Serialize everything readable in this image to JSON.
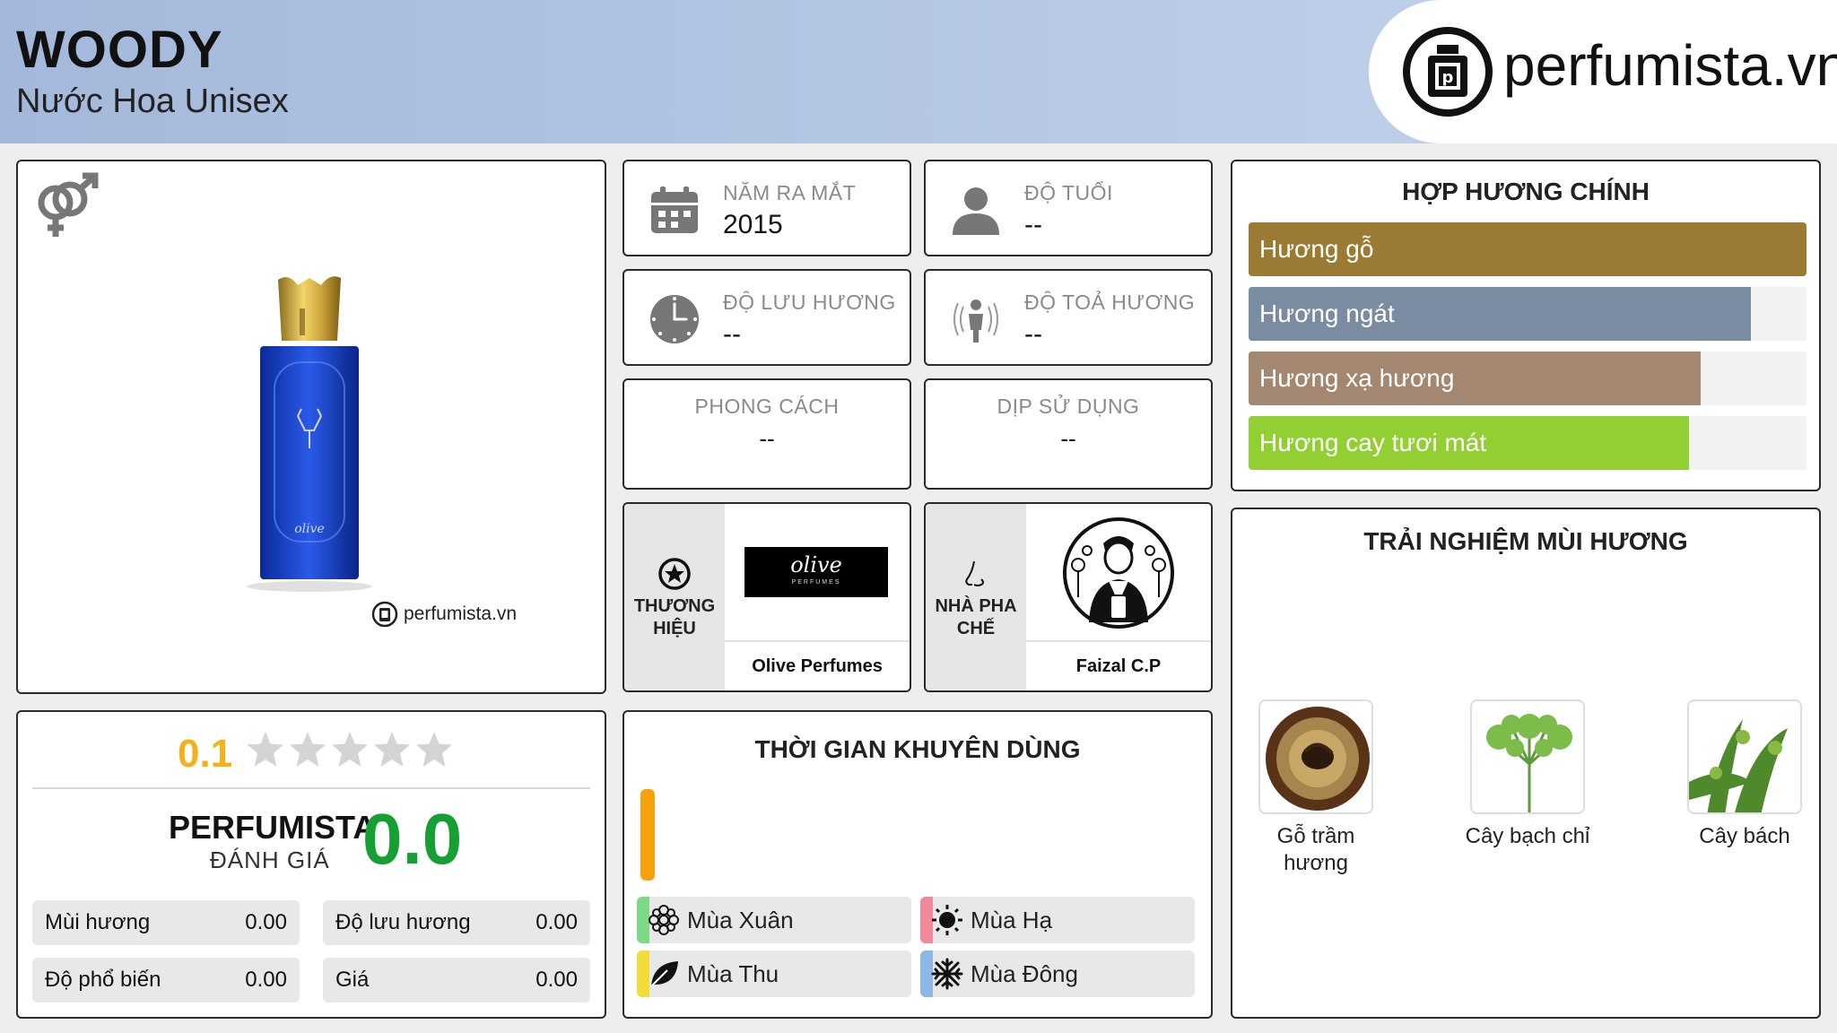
{
  "header": {
    "title": "WOODY",
    "subtitle": "Nước Hoa Unisex",
    "site_logo_text": "perfumista.vn"
  },
  "product": {
    "gender_icon": "unisex-gender-icon",
    "watermark": "perfumista.vn",
    "bottle_label": "olive"
  },
  "info": {
    "year": {
      "label": "NĂM RA MẮT",
      "value": "2015",
      "icon": "calendar-icon"
    },
    "age": {
      "label": "ĐỘ TUỔI",
      "value": "--",
      "icon": "person-icon"
    },
    "longevity": {
      "label": "ĐỘ LƯU HƯƠNG",
      "value": "--",
      "icon": "clock-icon"
    },
    "sillage": {
      "label": "ĐỘ TOẢ HƯƠNG",
      "value": "--",
      "icon": "radiating-person-icon"
    },
    "style": {
      "label": "PHONG CÁCH",
      "value": "--"
    },
    "occasion": {
      "label": "DỊP SỬ DỤNG",
      "value": "--"
    }
  },
  "brand": {
    "side_label": "THƯƠNG HIỆU",
    "name": "Olive Perfumes",
    "logo_text": "olive",
    "logo_sub": "PERFUMES",
    "icon": "star-badge-icon"
  },
  "perfumer": {
    "side_label": "NHÀ PHA CHẾ",
    "name": "Faizal C.P",
    "icon": "nose-icon"
  },
  "accords": {
    "title": "HỢP HƯƠNG CHÍNH",
    "items": [
      {
        "label": "Hương gỗ",
        "level": 1.0,
        "color": "#9b7b33"
      },
      {
        "label": "Hương ngát",
        "level": 0.9,
        "color": "#7a8ca1"
      },
      {
        "label": "Hương xạ hương",
        "level": 0.81,
        "color": "#a48770"
      },
      {
        "label": "Hương cay tươi mát",
        "level": 0.79,
        "color": "#92cf33"
      }
    ]
  },
  "experience": {
    "title": "TRẢI NGHIỆM MÙI HƯƠNG",
    "notes": [
      {
        "label": "Gỗ trầm hương",
        "icon": "agarwood-image"
      },
      {
        "label": "Cây bạch chỉ",
        "icon": "angelica-image"
      },
      {
        "label": "Cây bách",
        "icon": "cypress-image"
      }
    ]
  },
  "rating": {
    "user_score": "0.1",
    "stars_filled": 0.02,
    "pf_label": "PERFUMISTA",
    "pf_sub": "ĐÁNH GIÁ",
    "pf_score": "0.0",
    "metrics": [
      {
        "label": "Mùi hương",
        "value": "0.00"
      },
      {
        "label": "Độ lưu hương",
        "value": "0.00"
      },
      {
        "label": "Độ phổ biến",
        "value": "0.00"
      },
      {
        "label": "Giá",
        "value": "0.00"
      }
    ]
  },
  "season": {
    "title": "THỜI GIAN KHUYÊN DÙNG",
    "items": [
      {
        "label": "Mùa Xuân",
        "color": "#7dd987",
        "icon": "flower-icon"
      },
      {
        "label": "Mùa Hạ",
        "color": "#f08a9a",
        "icon": "sun-icon"
      },
      {
        "label": "Mùa Thu",
        "color": "#f1dc3a",
        "icon": "leaf-icon"
      },
      {
        "label": "Mùa Đông",
        "color": "#8cb8e8",
        "icon": "snowflake-icon"
      }
    ]
  }
}
